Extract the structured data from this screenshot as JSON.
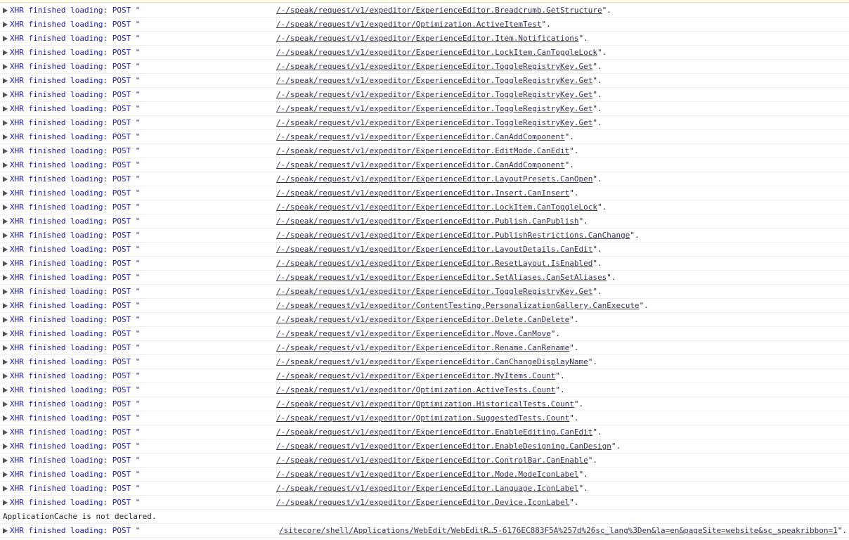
{
  "console": {
    "xhr_prefix": "XHR finished loading: POST \"",
    "line_suffix": "\".",
    "entries": [
      {
        "url": "/-/speak/request/v1/expeditor/ExperienceEditor.Breadcrumb.GetStructure"
      },
      {
        "url": "/-/speak/request/v1/expeditor/Optimization.ActiveItemTest"
      },
      {
        "url": "/-/speak/request/v1/expeditor/ExperienceEditor.Item.Notifications"
      },
      {
        "url": "/-/speak/request/v1/expeditor/ExperienceEditor.LockItem.CanToggleLock"
      },
      {
        "url": "/-/speak/request/v1/expeditor/ExperienceEditor.ToggleRegistryKey.Get"
      },
      {
        "url": "/-/speak/request/v1/expeditor/ExperienceEditor.ToggleRegistryKey.Get"
      },
      {
        "url": "/-/speak/request/v1/expeditor/ExperienceEditor.ToggleRegistryKey.Get"
      },
      {
        "url": "/-/speak/request/v1/expeditor/ExperienceEditor.ToggleRegistryKey.Get"
      },
      {
        "url": "/-/speak/request/v1/expeditor/ExperienceEditor.ToggleRegistryKey.Get"
      },
      {
        "url": "/-/speak/request/v1/expeditor/ExperienceEditor.CanAddComponent"
      },
      {
        "url": "/-/speak/request/v1/expeditor/ExperienceEditor.EditMode.CanEdit"
      },
      {
        "url": "/-/speak/request/v1/expeditor/ExperienceEditor.CanAddComponent"
      },
      {
        "url": "/-/speak/request/v1/expeditor/ExperienceEditor.LayoutPresets.CanOpen"
      },
      {
        "url": "/-/speak/request/v1/expeditor/ExperienceEditor.Insert.CanInsert"
      },
      {
        "url": "/-/speak/request/v1/expeditor/ExperienceEditor.LockItem.CanToggleLock"
      },
      {
        "url": "/-/speak/request/v1/expeditor/ExperienceEditor.Publish.CanPublish"
      },
      {
        "url": "/-/speak/request/v1/expeditor/ExperienceEditor.PublishRestrictions.CanChange"
      },
      {
        "url": "/-/speak/request/v1/expeditor/ExperienceEditor.LayoutDetails.CanEdit"
      },
      {
        "url": "/-/speak/request/v1/expeditor/ExperienceEditor.ResetLayout.IsEnabled"
      },
      {
        "url": "/-/speak/request/v1/expeditor/ExperienceEditor.SetAliases.CanSetAliases"
      },
      {
        "url": "/-/speak/request/v1/expeditor/ExperienceEditor.ToggleRegistryKey.Get"
      },
      {
        "url": "/-/speak/request/v1/expeditor/ContentTesting.PersonalizationGallery.CanExecute"
      },
      {
        "url": "/-/speak/request/v1/expeditor/ExperienceEditor.Delete.CanDelete"
      },
      {
        "url": "/-/speak/request/v1/expeditor/ExperienceEditor.Move.CanMove"
      },
      {
        "url": "/-/speak/request/v1/expeditor/ExperienceEditor.Rename.CanRename"
      },
      {
        "url": "/-/speak/request/v1/expeditor/ExperienceEditor.CanChangeDisplayName"
      },
      {
        "url": "/-/speak/request/v1/expeditor/ExperienceEditor.MyItems.Count"
      },
      {
        "url": "/-/speak/request/v1/expeditor/Optimization.ActiveTests.Count"
      },
      {
        "url": "/-/speak/request/v1/expeditor/Optimization.HistoricalTests.Count"
      },
      {
        "url": "/-/speak/request/v1/expeditor/Optimization.SuggestedTests.Count"
      },
      {
        "url": "/-/speak/request/v1/expeditor/ExperienceEditor.EnableEditing.CanEdit"
      },
      {
        "url": "/-/speak/request/v1/expeditor/ExperienceEditor.EnableDesigning.CanDesign"
      },
      {
        "url": "/-/speak/request/v1/expeditor/ExperienceEditor.ControlBar.CanEnable"
      },
      {
        "url": "/-/speak/request/v1/expeditor/ExperienceEditor.Mode.ModeIconLabel"
      },
      {
        "url": "/-/speak/request/v1/expeditor/ExperienceEditor.Language.IconLabel"
      },
      {
        "url": "/-/speak/request/v1/expeditor/ExperienceEditor.Device.IconLabel"
      }
    ],
    "notice": "ApplicationCache is not declared.",
    "last_entry": {
      "url": "/sitecore/shell/Applications/WebEdit/WebEditR…5-6176EC883F5A%257d%26sc_lang%3Den&la=en&pageSite=website&sc_speakribbon=1"
    }
  }
}
